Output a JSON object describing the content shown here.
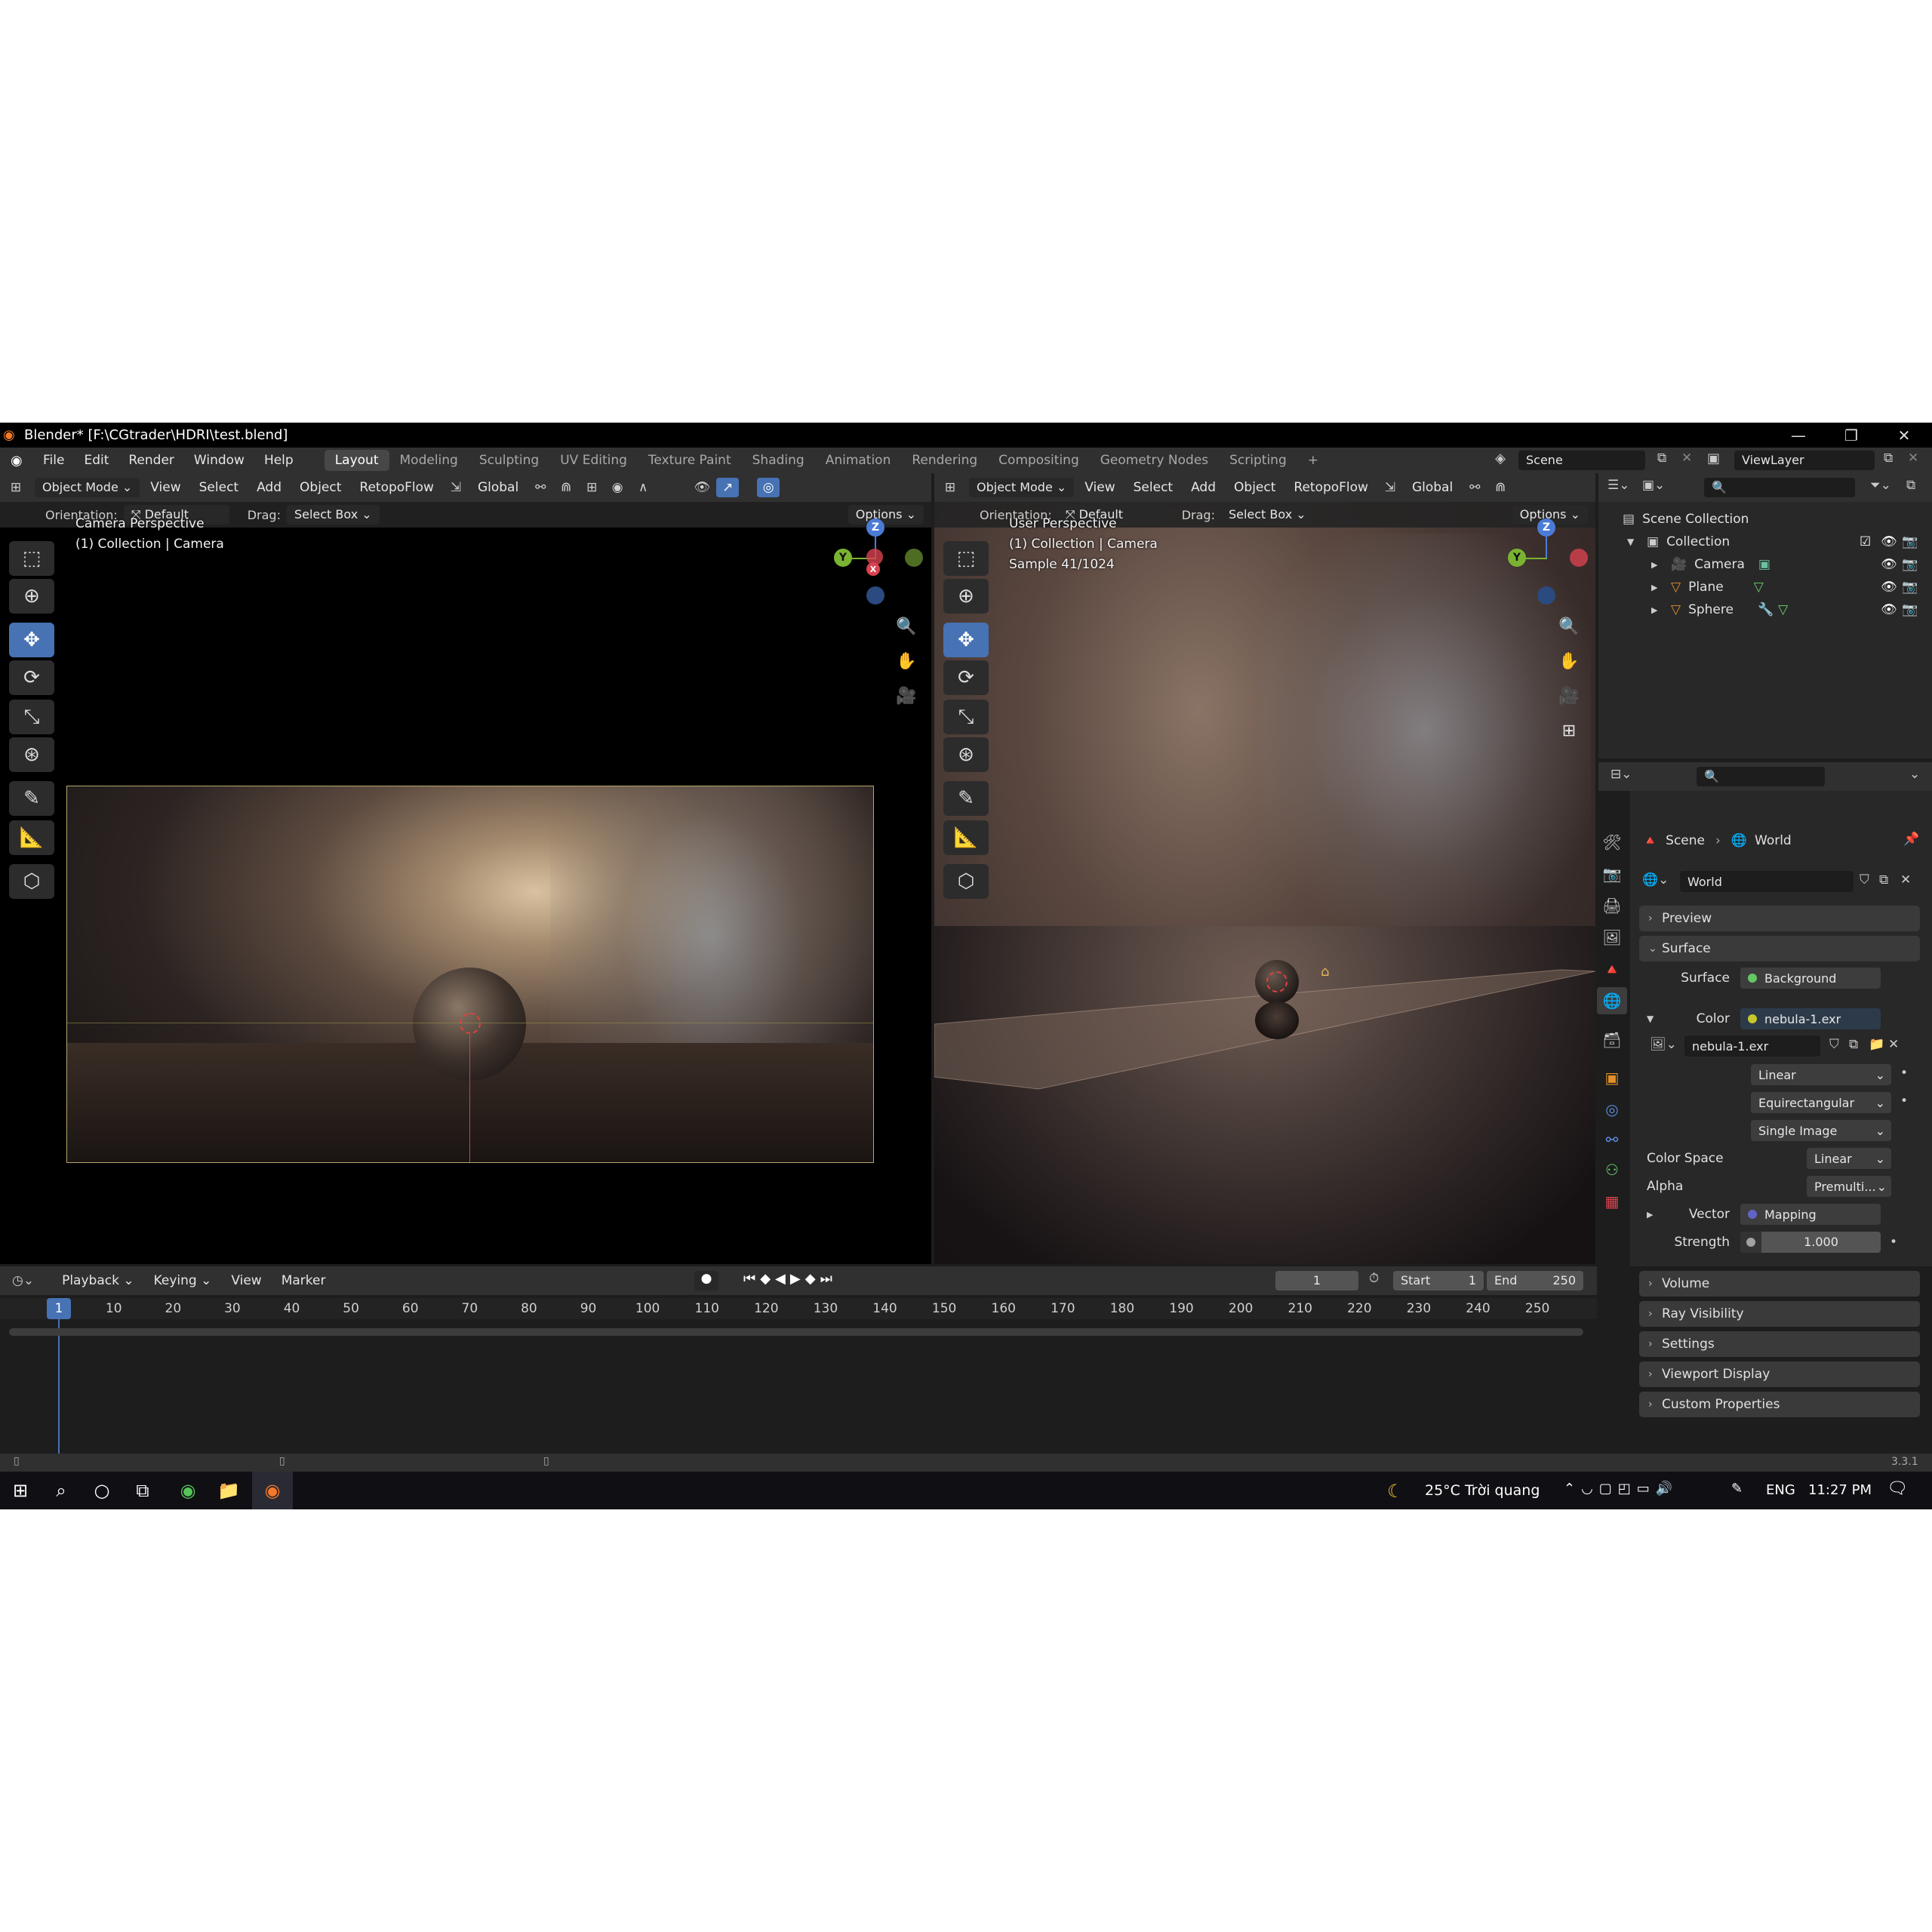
{
  "titlebar": {
    "title": "Blender* [F:\\CGtrader\\HDRI\\test.blend]"
  },
  "menu": [
    "File",
    "Edit",
    "Render",
    "Window",
    "Help"
  ],
  "workspaces": [
    "Layout",
    "Modeling",
    "Sculpting",
    "UV Editing",
    "Texture Paint",
    "Shading",
    "Animation",
    "Rendering",
    "Compositing",
    "Geometry Nodes",
    "Scripting",
    "+"
  ],
  "active_workspace": "Layout",
  "scene_field": "Scene",
  "viewlayer_field": "ViewLayer",
  "viewport_left": {
    "mode": "Object Mode",
    "menus": [
      "View",
      "Select",
      "Add",
      "Object",
      "RetopoFlow"
    ],
    "transform": "Global",
    "orientation_label": "Orientation:",
    "orientation_value": "Default",
    "drag_label": "Drag:",
    "drag_value": "Select Box",
    "options": "Options",
    "info_line1": "Camera Perspective",
    "info_line2": "(1) Collection | Camera"
  },
  "viewport_right": {
    "mode": "Object Mode",
    "menus": [
      "View",
      "Select",
      "Add",
      "Object",
      "RetopoFlow"
    ],
    "transform": "Global",
    "orientation_label": "Orientation:",
    "orientation_value": "Default",
    "drag_label": "Drag:",
    "drag_value": "Select Box",
    "options": "Options",
    "info_line1": "User Perspective",
    "info_line2": "(1) Collection | Camera",
    "info_line3": "Sample 41/1024"
  },
  "gizmo": {
    "z": "Z",
    "y": "Y",
    "x": "X"
  },
  "outliner": {
    "root": "Scene Collection",
    "collection": "Collection",
    "items": [
      "Camera",
      "Plane",
      "Sphere"
    ]
  },
  "properties": {
    "breadcrumb_scene": "Scene",
    "breadcrumb_world": "World",
    "world_name": "World",
    "sections": {
      "preview": "Preview",
      "surface": "Surface",
      "volume": "Volume",
      "ray_visibility": "Ray Visibility",
      "settings": "Settings",
      "viewport_display": "Viewport Display",
      "custom_properties": "Custom Properties"
    },
    "surface_label": "Surface",
    "surface_value": "Background",
    "color_label": "Color",
    "color_value": "nebula-1.exr",
    "image_name": "nebula-1.exr",
    "interpolation": "Linear",
    "projection": "Equirectangular",
    "source": "Single Image",
    "colorspace_label": "Color Space",
    "colorspace_value": "Linear",
    "alpha_label": "Alpha",
    "alpha_value": "Premulti...",
    "vector_label": "Vector",
    "vector_value": "Mapping",
    "strength_label": "Strength",
    "strength_value": "1.000"
  },
  "timeline": {
    "menus": [
      "Playback",
      "Keying",
      "View",
      "Marker"
    ],
    "current_frame": "1",
    "start_label": "Start",
    "start_value": "1",
    "end_label": "End",
    "end_value": "250",
    "ticks": [
      "1",
      "10",
      "20",
      "30",
      "40",
      "50",
      "60",
      "70",
      "80",
      "90",
      "100",
      "110",
      "120",
      "130",
      "140",
      "150",
      "160",
      "170",
      "180",
      "190",
      "200",
      "210",
      "220",
      "230",
      "240",
      "250"
    ]
  },
  "version": "3.3.1",
  "taskbar": {
    "weather": "25°C  Trời quang",
    "lang": "ENG",
    "time": "11:27 PM"
  },
  "colors": {
    "accent": "#4772b3",
    "header": "#303030",
    "panel": "#282828"
  }
}
